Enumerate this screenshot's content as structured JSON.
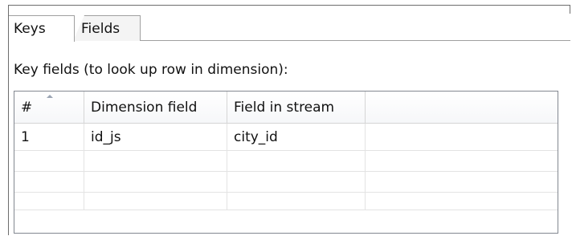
{
  "tabs": [
    {
      "label": "Keys",
      "active": true
    },
    {
      "label": "Fields",
      "active": false
    }
  ],
  "section": {
    "label": "Key fields (to look up row in dimension):"
  },
  "table": {
    "columns": [
      "#",
      "Dimension field",
      "Field in stream",
      ""
    ],
    "rows": [
      [
        "1",
        "id_js",
        "city_id",
        ""
      ],
      [
        "",
        "",
        "",
        ""
      ],
      [
        "",
        "",
        "",
        ""
      ],
      [
        "",
        "",
        "",
        ""
      ]
    ]
  }
}
